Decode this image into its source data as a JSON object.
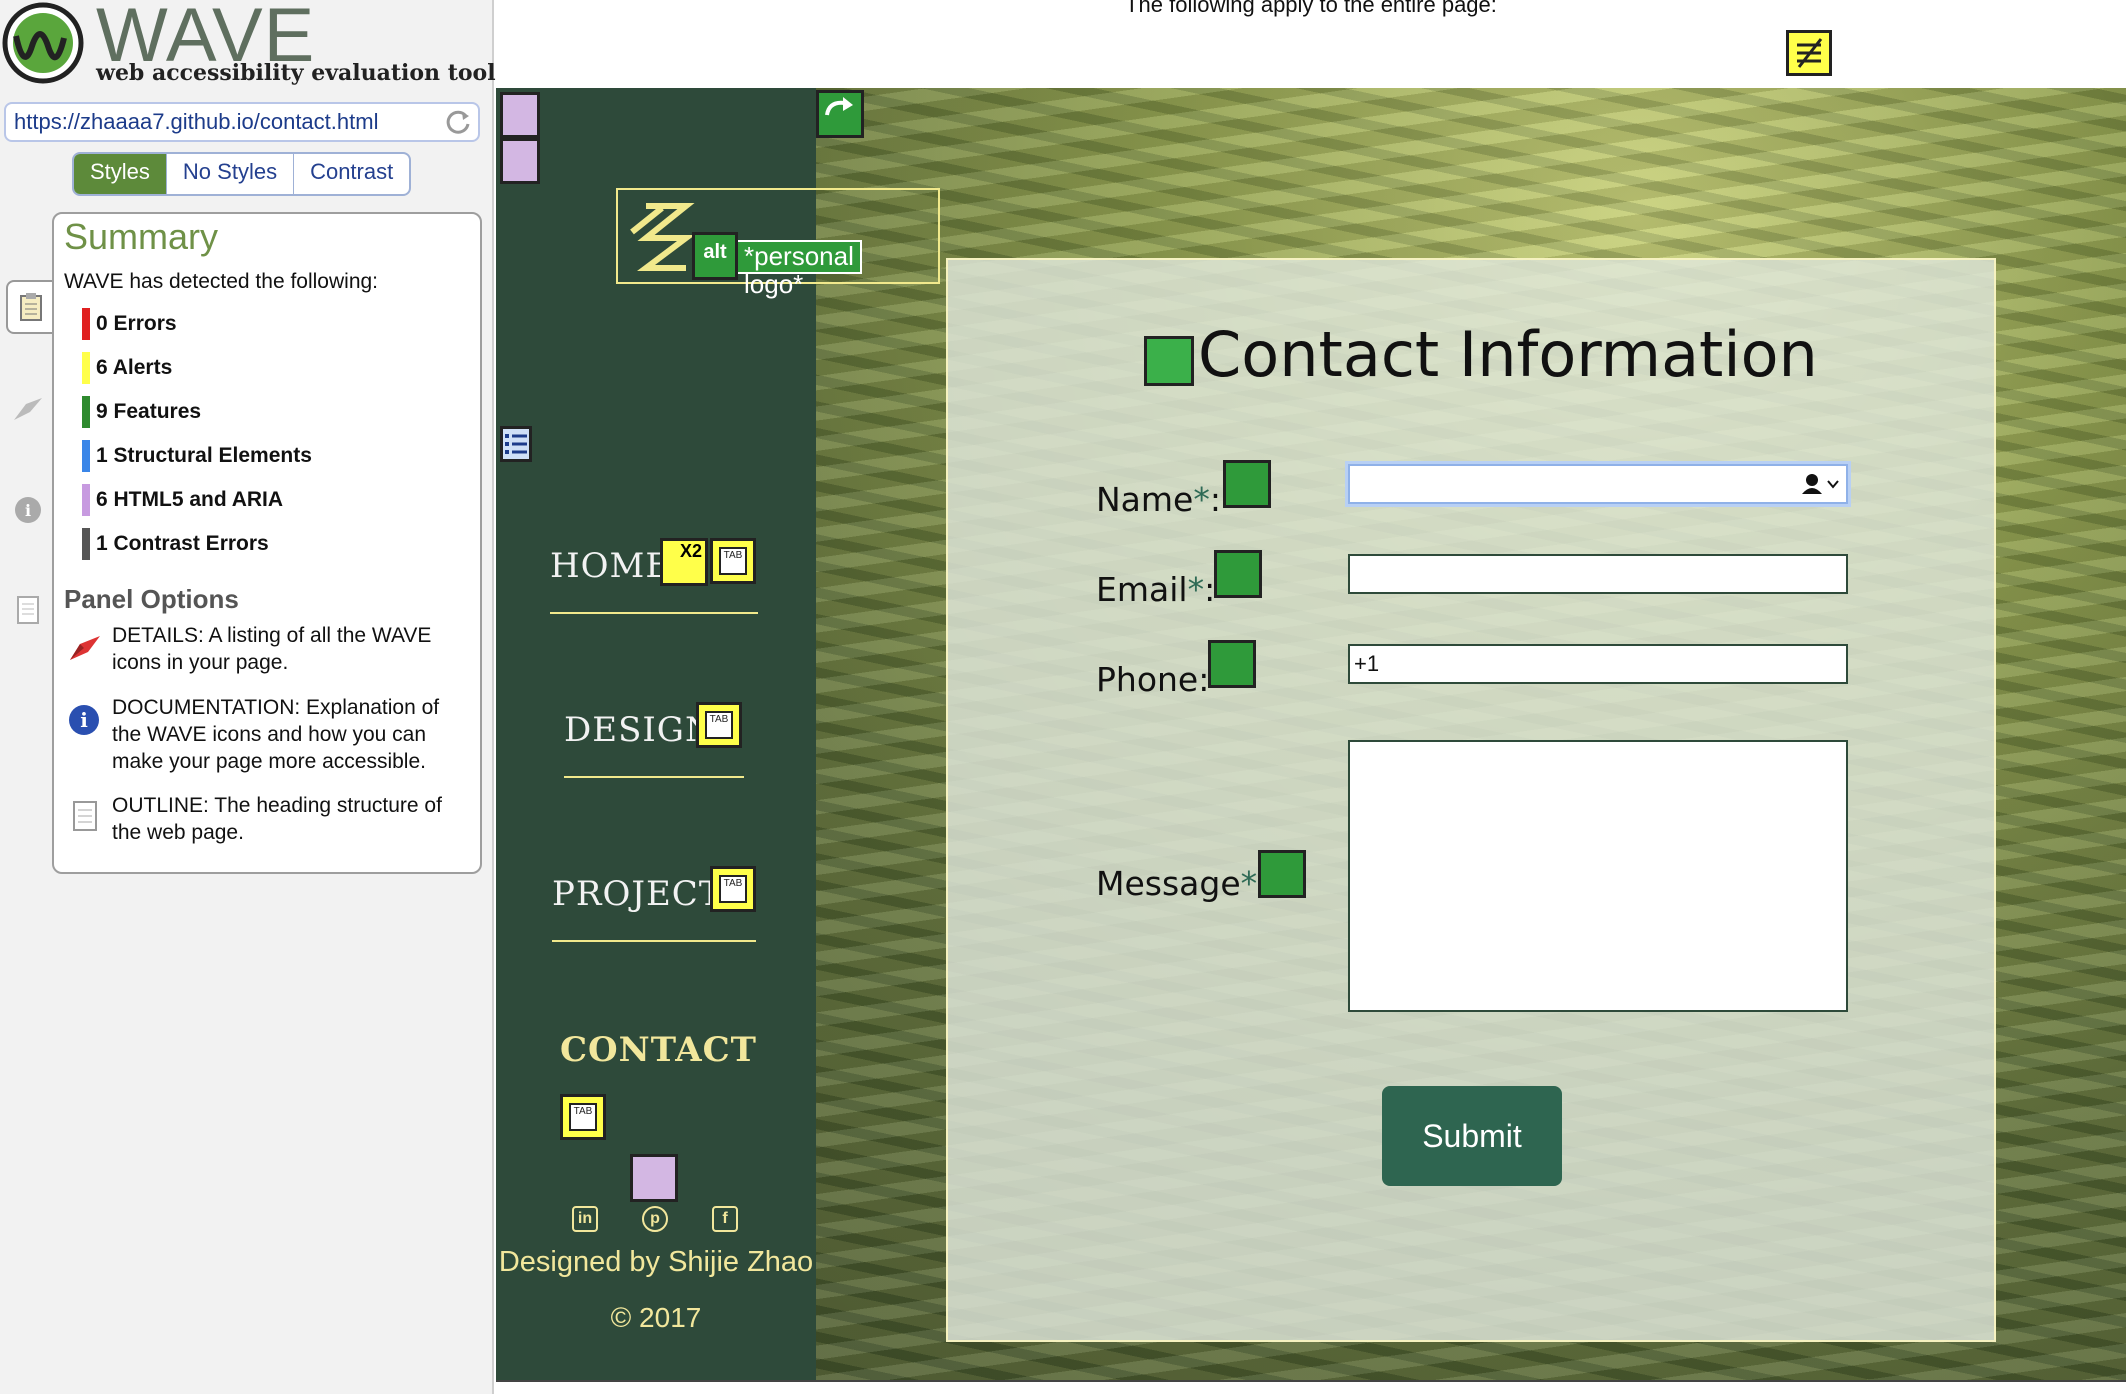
{
  "wave": {
    "brand": "WAVE",
    "subtitle": "web accessibility evaluation tool",
    "url": "https://zhaaaa7.github.io/contact.html",
    "style_tabs": [
      "Styles",
      "No Styles",
      "Contrast"
    ],
    "active_tab": "Styles",
    "summary": {
      "title": "Summary",
      "intro": "WAVE has detected the following:",
      "items": [
        {
          "label": "0 Errors",
          "color": "#e02020"
        },
        {
          "label": "6 Alerts",
          "color": "#ffff4a"
        },
        {
          "label": "9 Features",
          "color": "#2e8a2e"
        },
        {
          "label": "1 Structural Elements",
          "color": "#3a86e8"
        },
        {
          "label": "6 HTML5 and ARIA",
          "color": "#c79ae0"
        },
        {
          "label": "1 Contrast Errors",
          "color": "#555555"
        }
      ]
    },
    "panel_options": {
      "title": "Panel Options",
      "details": "DETAILS: A listing of all the WAVE icons in your page.",
      "documentation": "DOCUMENTATION: Explanation of the WAVE icons and how you can make your page more accessible.",
      "outline": "OUTLINE: The heading structure of the web page."
    },
    "apply_text": "The following apply to the entire page:"
  },
  "site": {
    "logo_alt": "*personal logo*",
    "alt_badge": "alt",
    "nav": [
      "HOME",
      "DESIGN",
      "PROJECT",
      "CONTACT"
    ],
    "home_badge": "X2",
    "tab_badge": "TAB",
    "footer_designed": "Designed by Shijie Zhao",
    "footer_copy": "© 2017",
    "nav_color": "#2e4a3a",
    "accent": "#f2e79c"
  },
  "contact": {
    "title": "Contact Information",
    "fields": [
      {
        "label": "Name",
        "required": true,
        "value": ""
      },
      {
        "label": "Email",
        "required": true,
        "value": ""
      },
      {
        "label": "Phone",
        "required": false,
        "value": "+1"
      },
      {
        "label": "Message",
        "required": true,
        "value": ""
      }
    ],
    "required_mark": "*",
    "colon": ":",
    "submit": "Submit"
  }
}
